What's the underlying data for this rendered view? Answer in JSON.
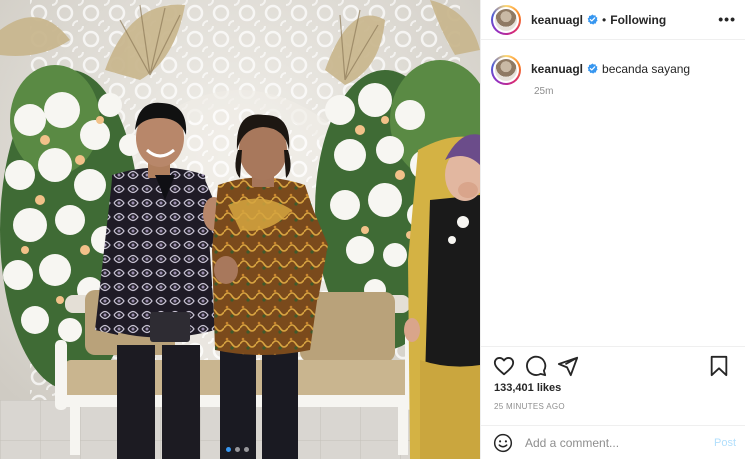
{
  "post": {
    "photo": {
      "description_icon": "wedding-photo",
      "active_slide": 1,
      "slide_count": 3
    },
    "header": {
      "username": "keanuagl",
      "verified_icon": "verified-badge-icon",
      "separator": "•",
      "follow_status": "Following",
      "more_icon": "more-options-icon"
    },
    "caption": {
      "username": "keanuagl",
      "text": "becanda sayang",
      "time": "25m"
    },
    "actions": {
      "like_icon": "heart-icon",
      "comment_icon": "comment-icon",
      "share_icon": "share-icon",
      "save_icon": "bookmark-icon"
    },
    "likes": "133,401 likes",
    "timestamp": "25 MINUTES AGO",
    "comment_box": {
      "emoji_icon": "emoji-icon",
      "placeholder": "Add a comment...",
      "post_label": "Post"
    },
    "colors": {
      "verified": "#3897f0",
      "muted": "#8e8e8e",
      "post_disabled": "#b2dffc",
      "divider": "#efefef"
    }
  }
}
